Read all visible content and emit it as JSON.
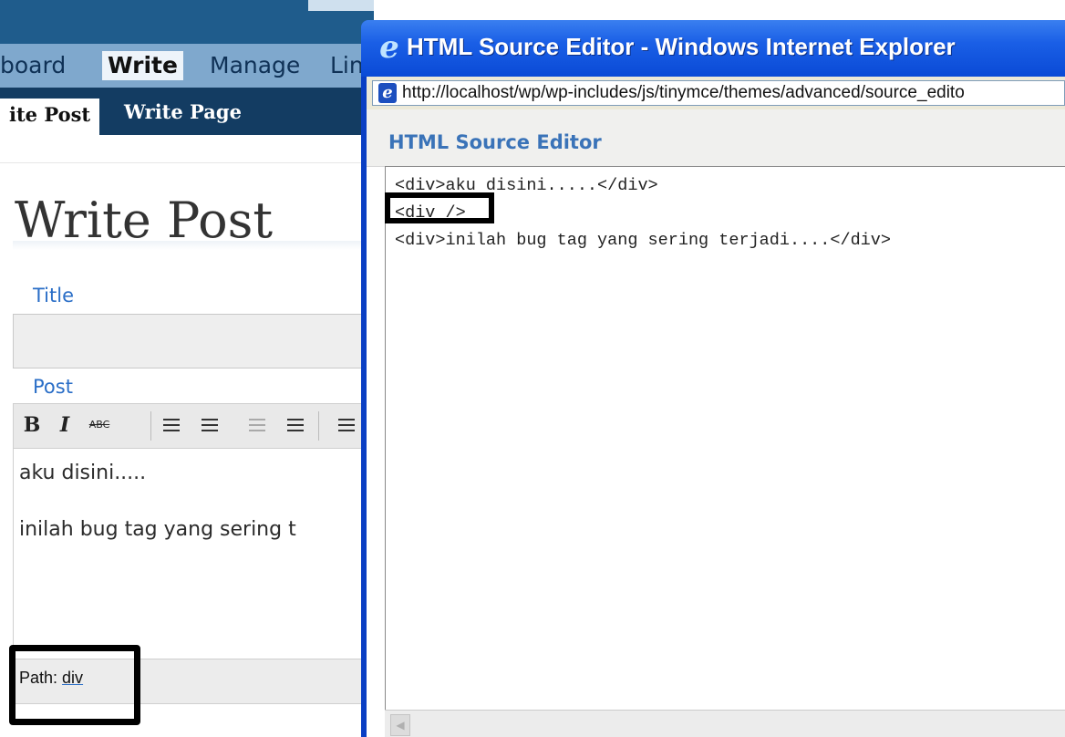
{
  "wordpress": {
    "menu": [
      "board",
      "Write",
      "Manage",
      "Lin"
    ],
    "active_menu": "Write",
    "submenu": [
      "ite Post",
      "Write Page"
    ],
    "page_title": "Write Post",
    "title_label": "Title",
    "title_value": "",
    "post_label": "Post",
    "toolbar": {
      "bold": "B",
      "italic": "I",
      "strikethrough": "ABC"
    },
    "editor_lines": [
      "aku disini.....",
      "inilah bug tag yang sering t"
    ],
    "status_path_label": "Path:",
    "status_path_value": "div"
  },
  "ie_window": {
    "title": "HTML Source Editor - Windows Internet Explorer",
    "url": "http://localhost/wp/wp-includes/js/tinymce/themes/advanced/source_edito",
    "heading": "HTML Source Editor",
    "code_lines": [
      "<div>aku disini.....</div>",
      "<div />",
      "<div>inilah bug tag yang sering terjadi....</div>"
    ]
  },
  "colors": {
    "wp_menu_bg": "#7fa8cd",
    "wp_submenu_bg": "#133c62",
    "ie_titlebar": "#1a5fe6",
    "label_blue": "#2a6ec7",
    "highlight_box": "#000000"
  }
}
